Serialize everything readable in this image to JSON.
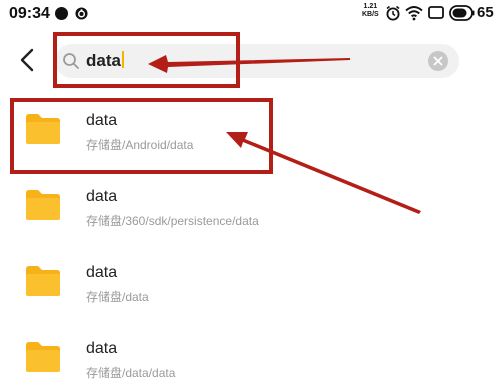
{
  "status_bar": {
    "time": "09:34",
    "net_speed_value": "1.21",
    "net_speed_unit": "KB/S",
    "battery_level": "65"
  },
  "search": {
    "query": "data",
    "icon": "search-icon"
  },
  "results": [
    {
      "name": "data",
      "path": "存储盘/Android/data"
    },
    {
      "name": "data",
      "path": "存储盘/360/sdk/persistence/data"
    },
    {
      "name": "data",
      "path": "存储盘/data"
    },
    {
      "name": "data",
      "path": "存储盘/data/data"
    }
  ],
  "colors": {
    "folder": "#f7b21a",
    "annotation": "#b31e17",
    "caret": "#f3b400"
  }
}
